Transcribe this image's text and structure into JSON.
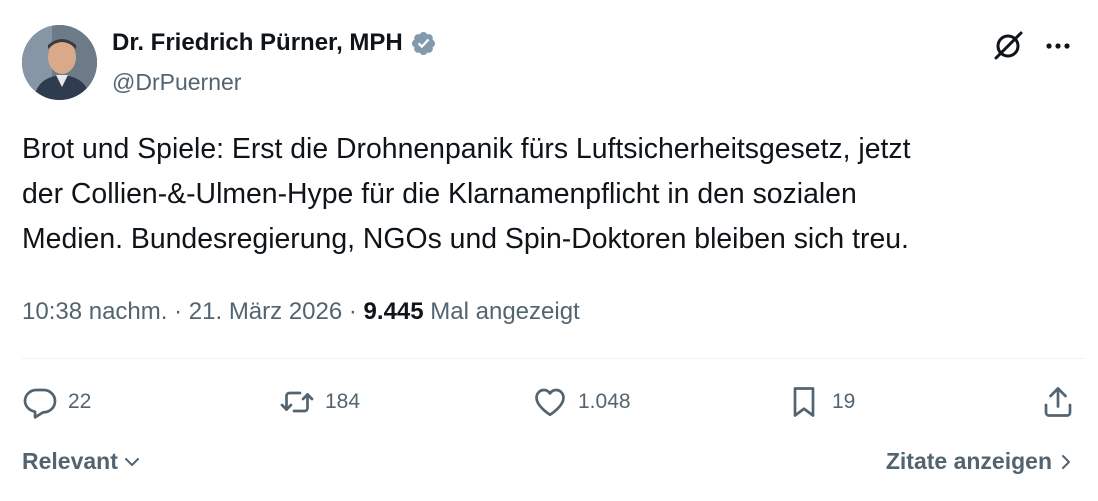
{
  "author": {
    "display_name": "Dr. Friedrich Pürner, MPH",
    "handle": "@DrPuerner",
    "verified_color": "#829aab"
  },
  "tweet": {
    "text": "Brot und Spiele: Erst die Drohnenpanik fürs Luftsicherheitsgesetz, jetzt\nder Collien-&-Ulmen-Hype für die Klarnamenpflicht in den sozialen\nMedien. Bundesregierung, NGOs und Spin-Doktoren bleiben sich treu.",
    "time": "10:38 nachm.",
    "separator": "·",
    "date": "21. März 2026",
    "views_count": "9.445",
    "views_label": "Mal angezeigt"
  },
  "actions": {
    "replies": "22",
    "reposts": "184",
    "likes": "1.048",
    "bookmarks": "19"
  },
  "footer": {
    "sort_label": "Relevant",
    "quotes_label": "Zitate anzeigen"
  },
  "icons": {
    "grok": "grok-icon",
    "more": "more-icon",
    "reply": "reply-icon",
    "repost": "repost-icon",
    "like": "heart-icon",
    "bookmark": "bookmark-icon",
    "share": "share-icon"
  },
  "colors": {
    "text": "#0f1419",
    "secondary": "#536471",
    "divider": "#eff3f4"
  }
}
